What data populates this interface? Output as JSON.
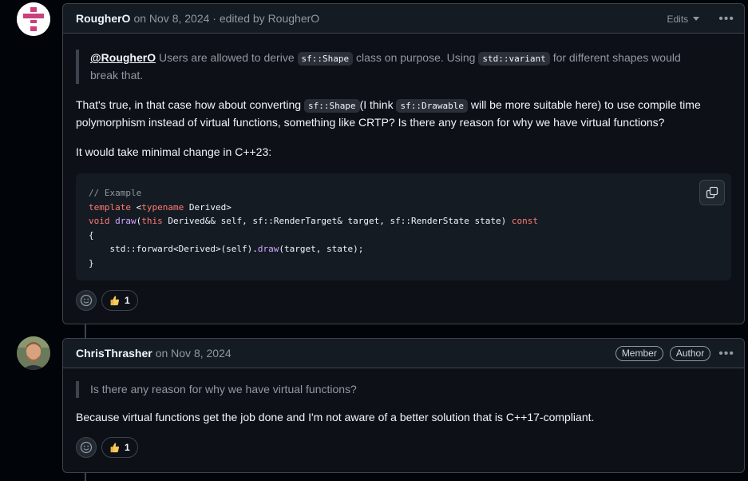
{
  "comments": [
    {
      "author": "RougherO",
      "meta": "on Nov 8, 2024 · edited by RougherO",
      "edits_label": "Edits",
      "quote": {
        "mention": "@RougherO",
        "text_1": " Users are allowed to derive ",
        "code_1": "sf::Shape",
        "text_2": " class on purpose. Using ",
        "code_2": "std::variant",
        "text_3": " for different shapes would break that."
      },
      "para1": {
        "text_1": "That's true, in that case how about converting ",
        "code_1": "sf::Shape",
        "text_2": "(I think ",
        "code_2": "sf::Drawable",
        "text_3": " will be more suitable here) to use compile time polymorphism instead of virtual functions, something like CRTP? Is there any reason for why we have virtual functions?"
      },
      "para2": "It would take minimal change in C++23:",
      "code": {
        "line1_comment": "// Example",
        "line2_kw": "template",
        "line2_rest_a": " <",
        "line2_kw2": "typename",
        "line2_rest_b": " Derived>",
        "line3_kw": "void",
        "line3_fn": "draw",
        "line3_a": "(",
        "line3_kw2": "this",
        "line3_b": " Derived&& self, sf::RenderTarget& target, sf::RenderState state) ",
        "line3_kw3": "const",
        "line4": "{",
        "line5_a": "    std::forward<Derived>(self).",
        "line5_fn": "draw",
        "line5_b": "(target, state);",
        "line6": "}"
      },
      "reaction_count": "1"
    },
    {
      "author": "ChrisThrasher",
      "meta": "on Nov 8, 2024",
      "badges": [
        "Member",
        "Author"
      ],
      "quote": "Is there any reason for why we have virtual functions?",
      "para1": "Because virtual functions get the job done and I'm not aware of a better solution that is C++17-compliant.",
      "reaction_count": "1"
    }
  ],
  "icons": {
    "copy": "copy-icon",
    "smiley": "smiley-icon",
    "thumbs_up": "thumbs-up-icon",
    "kebab": "kebab-horizontal-icon"
  },
  "colors": {
    "background": "#010409",
    "comment_bg": "#0d1117",
    "border": "#3d444d",
    "muted_text": "#9198a1",
    "avatar_pink": "#c9407b"
  }
}
